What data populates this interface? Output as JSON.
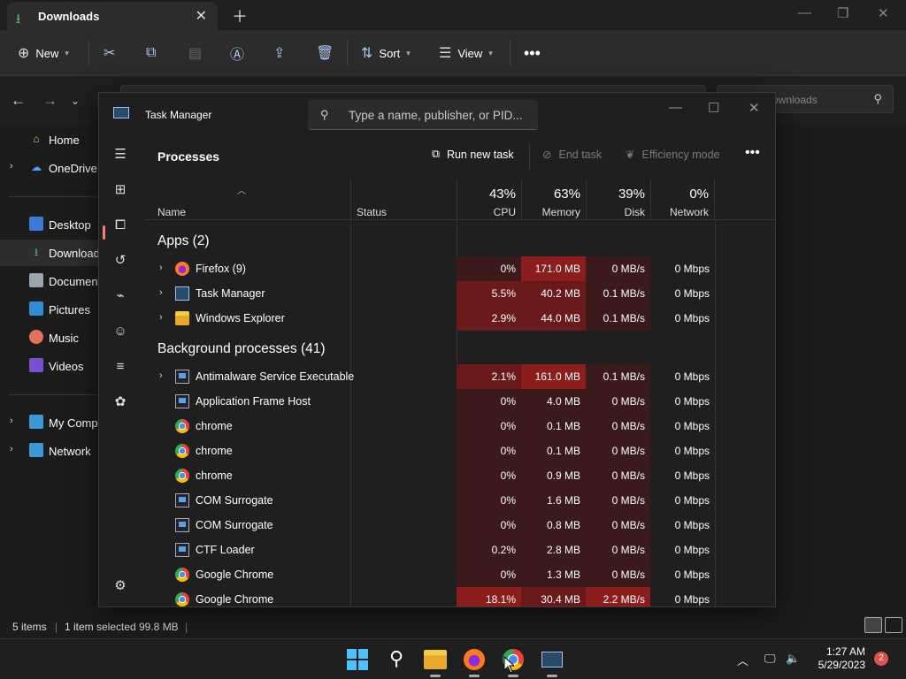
{
  "explorer": {
    "tab_title": "Downloads",
    "toolbar": {
      "new": "New",
      "sort": "Sort",
      "view": "View"
    },
    "search_placeholder": "ownloads",
    "sidebar": [
      {
        "label": "Home",
        "icon": "home-icon",
        "chevron": false
      },
      {
        "label": "OneDrive",
        "icon": "cloud-icon",
        "chevron": true
      },
      {
        "label": "Desktop",
        "icon": "desktop-icon",
        "chevron": false
      },
      {
        "label": "Downloads",
        "icon": "download-icon",
        "chevron": false
      },
      {
        "label": "Documents",
        "icon": "document-icon",
        "chevron": false
      },
      {
        "label": "Pictures",
        "icon": "pictures-icon",
        "chevron": false
      },
      {
        "label": "Music",
        "icon": "music-icon",
        "chevron": false
      },
      {
        "label": "Videos",
        "icon": "videos-icon",
        "chevron": false
      },
      {
        "label": "My Computer",
        "icon": "computer-icon",
        "chevron": true
      },
      {
        "label": "Network",
        "icon": "network-icon",
        "chevron": true
      }
    ],
    "status": {
      "items": "5 items",
      "selected": "1 item selected",
      "size": "99.8 MB"
    }
  },
  "taskmanager": {
    "title": "Task Manager",
    "search_placeholder": "Type a name, publisher, or PID...",
    "page_title": "Processes",
    "actions": {
      "run": "Run new task",
      "end": "End task",
      "efficiency": "Efficiency mode"
    },
    "columns": {
      "name": "Name",
      "status": "Status",
      "cpu_pct": "43%",
      "cpu": "CPU",
      "mem_pct": "63%",
      "mem": "Memory",
      "disk_pct": "39%",
      "disk": "Disk",
      "net_pct": "0%",
      "net": "Network"
    },
    "groups": {
      "apps": "Apps (2)",
      "background": "Background processes (41)"
    },
    "apps": [
      {
        "name": "Firefox (9)",
        "icon": "firefox-icon",
        "cpu": "0%",
        "mem": "171.0 MB",
        "disk": "0 MB/s",
        "net": "0 Mbps"
      },
      {
        "name": "Task Manager",
        "icon": "taskmanager-icon",
        "cpu": "5.5%",
        "mem": "40.2 MB",
        "disk": "0.1 MB/s",
        "net": "0 Mbps"
      },
      {
        "name": "Windows Explorer",
        "icon": "folder-icon",
        "cpu": "2.9%",
        "mem": "44.0 MB",
        "disk": "0.1 MB/s",
        "net": "0 Mbps"
      }
    ],
    "background": [
      {
        "name": "Antimalware Service Executable",
        "icon": "service-icon",
        "expand": true,
        "cpu": "2.1%",
        "mem": "161.0 MB",
        "disk": "0.1 MB/s",
        "net": "0 Mbps"
      },
      {
        "name": "Application Frame Host",
        "icon": "service-icon",
        "expand": false,
        "cpu": "0%",
        "mem": "4.0 MB",
        "disk": "0 MB/s",
        "net": "0 Mbps"
      },
      {
        "name": "chrome",
        "icon": "chrome-icon",
        "expand": false,
        "cpu": "0%",
        "mem": "0.1 MB",
        "disk": "0 MB/s",
        "net": "0 Mbps"
      },
      {
        "name": "chrome",
        "icon": "chrome-icon",
        "expand": false,
        "cpu": "0%",
        "mem": "0.1 MB",
        "disk": "0 MB/s",
        "net": "0 Mbps"
      },
      {
        "name": "chrome",
        "icon": "chrome-icon",
        "expand": false,
        "cpu": "0%",
        "mem": "0.9 MB",
        "disk": "0 MB/s",
        "net": "0 Mbps"
      },
      {
        "name": "COM Surrogate",
        "icon": "service-icon",
        "expand": false,
        "cpu": "0%",
        "mem": "1.6 MB",
        "disk": "0 MB/s",
        "net": "0 Mbps"
      },
      {
        "name": "COM Surrogate",
        "icon": "service-icon",
        "expand": false,
        "cpu": "0%",
        "mem": "0.8 MB",
        "disk": "0 MB/s",
        "net": "0 Mbps"
      },
      {
        "name": "CTF Loader",
        "icon": "service-icon",
        "expand": false,
        "cpu": "0.2%",
        "mem": "2.8 MB",
        "disk": "0 MB/s",
        "net": "0 Mbps"
      },
      {
        "name": "Google Chrome",
        "icon": "chrome-icon",
        "expand": false,
        "cpu": "0%",
        "mem": "1.3 MB",
        "disk": "0 MB/s",
        "net": "0 Mbps"
      },
      {
        "name": "Google Chrome",
        "icon": "chrome-icon",
        "expand": false,
        "cpu": "18.1%",
        "mem": "30.4 MB",
        "disk": "2.2 MB/s",
        "net": "0 Mbps"
      }
    ]
  },
  "taskbar": {
    "time": "1:27 AM",
    "date": "5/29/2023",
    "notifications": "2"
  },
  "colors": {
    "heat_low": "#3a1a1a",
    "heat_mid": "#6a1a1a",
    "heat_high": "#8b1d1d",
    "accent": "#f08080"
  }
}
